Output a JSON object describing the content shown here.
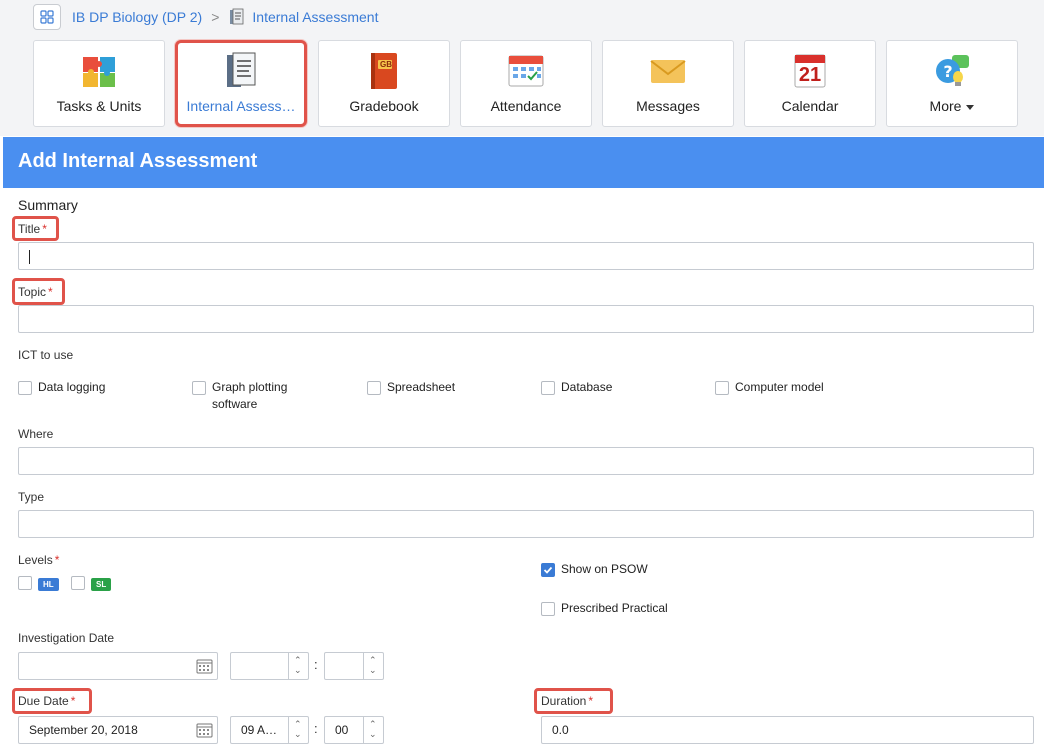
{
  "breadcrumb": {
    "course": "IB DP Biology (DP 2)",
    "separator": ">",
    "page": "Internal Assessment"
  },
  "tiles": [
    {
      "label": "Tasks & Units",
      "icon": "puzzle-icon"
    },
    {
      "label": "Internal Assess…",
      "icon": "document-icon",
      "active": true
    },
    {
      "label": "Gradebook",
      "icon": "gradebook-icon"
    },
    {
      "label": "Attendance",
      "icon": "attendance-calendar-icon"
    },
    {
      "label": "Messages",
      "icon": "envelope-icon"
    },
    {
      "label": "Calendar",
      "icon": "calendar-icon",
      "calendar_day": "21"
    },
    {
      "label": "More",
      "icon": "help-chat-icon"
    }
  ],
  "gradebook_badge": "GB",
  "form": {
    "heading": "Add Internal Assessment",
    "summary": "Summary",
    "title_label": "Title",
    "topic_label": "Topic",
    "required_mark": "*",
    "ict_label": "ICT to use",
    "ict_options": [
      "Data logging",
      "Graph plotting",
      "software",
      "Spreadsheet",
      "Database",
      "Computer model"
    ],
    "where_label": "Where",
    "type_label": "Type",
    "levels_label": "Levels",
    "level_hl": "HL",
    "level_sl": "SL",
    "show_psow": "Show on PSOW",
    "prescribed": "Prescribed Practical",
    "investigation_label": "Investigation Date",
    "due_label": "Due Date",
    "due_date": "September 20, 2018",
    "due_hour": "09 A…",
    "due_minute": "00",
    "time_sep": ":",
    "duration_label": "Duration",
    "duration_value": "0.0"
  },
  "colors": {
    "header_bg": "#4a8ff0",
    "link": "#3a7bd5",
    "highlight": "#e0534a",
    "hl_badge": "#3a7bd5",
    "sl_badge": "#2aa148"
  }
}
